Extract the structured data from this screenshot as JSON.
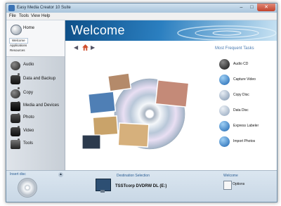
{
  "window": {
    "title": "Easy Media Creator 10 Suite",
    "minimize": "–",
    "maximize": "□",
    "close": "✕"
  },
  "menu": [
    "File",
    "Tools",
    "View",
    "Help"
  ],
  "sidebar": {
    "home": {
      "label": "Home",
      "subitems": [
        "Welcome",
        "Applications",
        "Resources"
      ]
    },
    "items": [
      {
        "label": "Audio",
        "icon": "audio-icon"
      },
      {
        "label": "Data and Backup",
        "icon": "data-backup-icon"
      },
      {
        "label": "Copy",
        "icon": "copy-icon"
      },
      {
        "label": "Media and Devices",
        "icon": "media-devices-icon"
      },
      {
        "label": "Photo",
        "icon": "photo-icon"
      },
      {
        "label": "Video",
        "icon": "video-icon"
      },
      {
        "label": "Tools",
        "icon": "tools-icon"
      }
    ]
  },
  "main": {
    "banner_title": "Welcome",
    "nav": {
      "back": "◀",
      "forward": "▶"
    },
    "tasks_title": "Most Frequent Tasks",
    "tasks": [
      "Audio CD",
      "Capture Video",
      "Copy Disc",
      "Data Disc",
      "Express Labeler",
      "Import Photos"
    ]
  },
  "bottom": {
    "insert_disc_title": "Insert disc",
    "insert_arrow": "▲",
    "destination_title": "Destination Selection",
    "drive_label": "TSSTcorp DVDRW DL (E:)",
    "welcome_title": "Welcome",
    "options_label": "Options"
  },
  "colors": {
    "accent": "#1f6fb3",
    "banner_dark": "#0e4f88",
    "sidebar_bg": "#d6dce3"
  }
}
